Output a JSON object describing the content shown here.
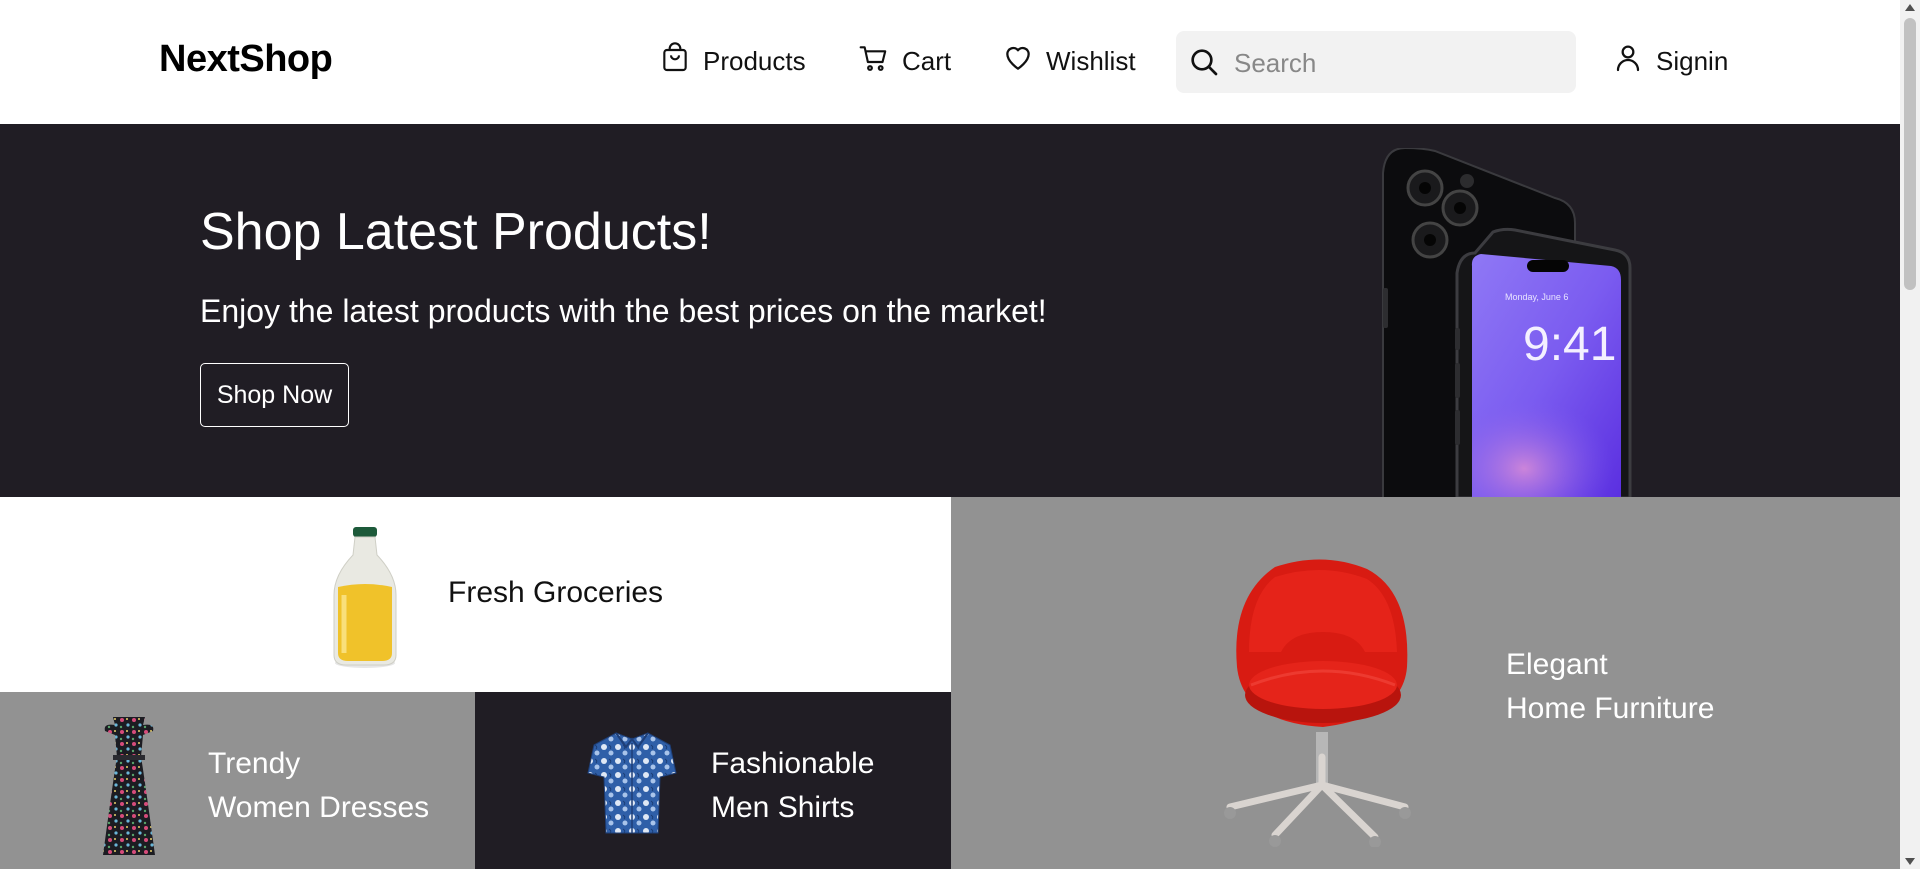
{
  "brand": {
    "name": "NextShop"
  },
  "nav": {
    "products": {
      "label": "Products",
      "icon": "shopping-bag-icon"
    },
    "cart": {
      "label": "Cart",
      "icon": "cart-icon"
    },
    "wishlist": {
      "label": "Wishlist",
      "icon": "heart-icon"
    },
    "signin": {
      "label": "Signin",
      "icon": "user-icon"
    }
  },
  "search": {
    "placeholder": "Search",
    "value": "",
    "icon": "search-icon"
  },
  "hero": {
    "title": "Shop Latest Products!",
    "subtitle": "Enjoy the latest products with the best prices on the market!",
    "button_label": "Shop Now",
    "phone_date": "Monday, June 6",
    "phone_time": "9:41"
  },
  "categories": {
    "groceries": {
      "label": "Fresh Groceries",
      "icon": "juice-bottle-image"
    },
    "furniture": {
      "line1": "Elegant",
      "line2": "Home Furniture",
      "icon": "office-chair-image"
    },
    "dresses": {
      "line1": "Trendy",
      "line2": "Women Dresses",
      "icon": "floral-dress-image"
    },
    "shirts": {
      "line1": "Fashionable",
      "line2": "Men Shirts",
      "icon": "floral-shirt-image"
    }
  },
  "colors": {
    "dark": "#201d24",
    "gray": "#929292",
    "white": "#ffffff",
    "search_bg": "#f2f2f2",
    "phone_screen": "#7b5cf0",
    "chair_red": "#d81b12"
  }
}
